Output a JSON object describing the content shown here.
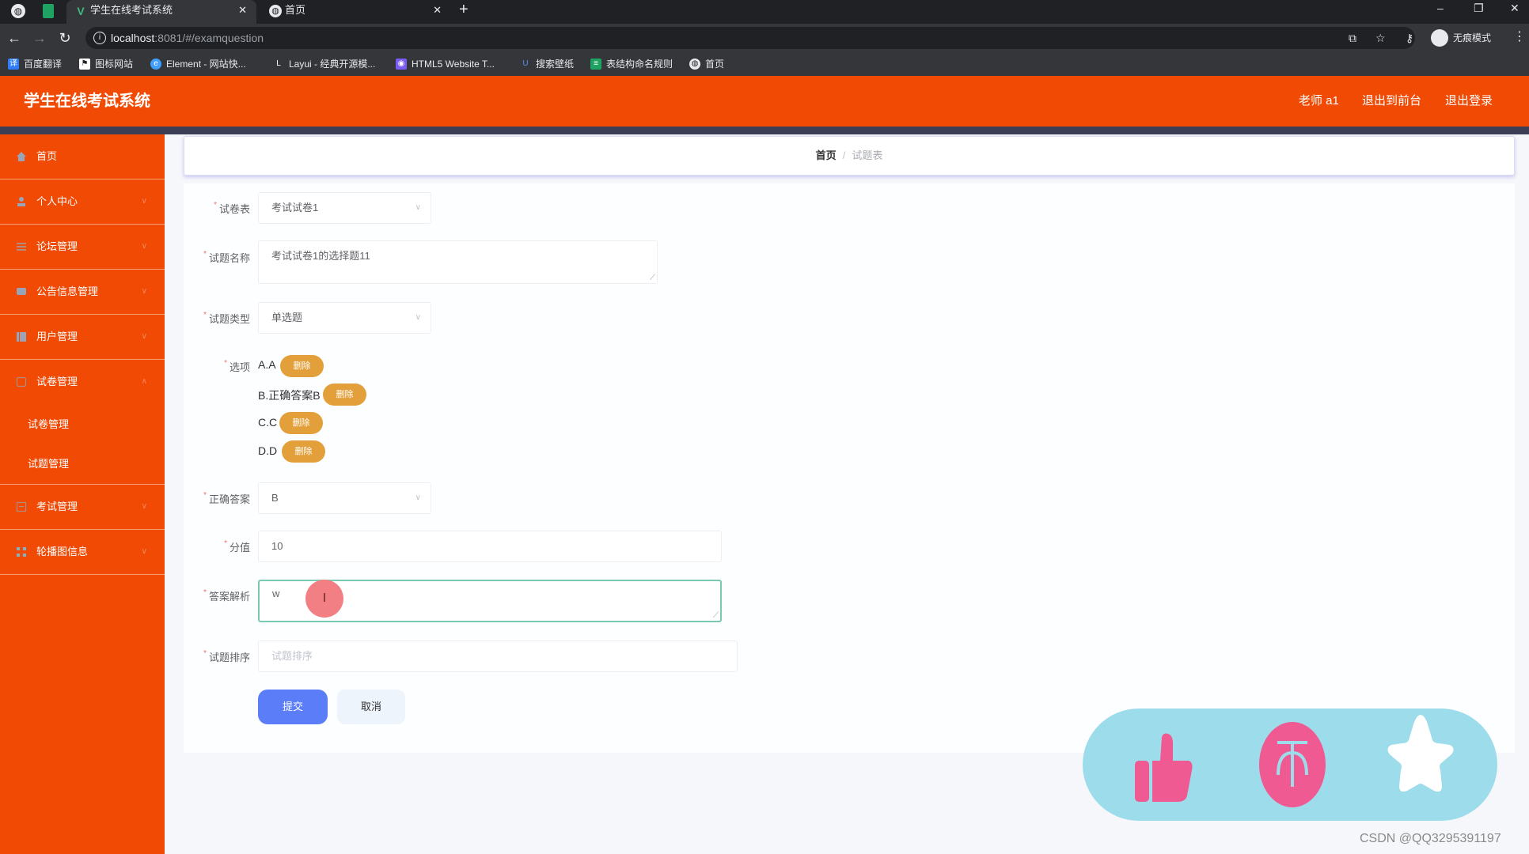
{
  "browser": {
    "tabs": [
      {
        "title": "学生在线考试系统",
        "icon": "vue-logo-icon",
        "active": true
      },
      {
        "title": "首页",
        "icon": "globe-icon",
        "active": false
      }
    ],
    "tab_close_glyph": "✕",
    "new_tab_glyph": "+",
    "url_host": "localhost",
    "url_rest": ":8081/#/examquestion",
    "profile_label": "无痕模式",
    "bookmarks": [
      {
        "label": "百度翻译",
        "icon": "baidu-translate-icon",
        "color": "#2f7cf6"
      },
      {
        "label": "图标网站",
        "icon": "flag-icon",
        "color": "#ffffff"
      },
      {
        "label": "Element - 网站快...",
        "icon": "element-icon",
        "color": "#409eff"
      },
      {
        "label": "Layui - 经典开源模...",
        "icon": "layui-icon",
        "color": "#35363a"
      },
      {
        "label": "HTML5 Website T...",
        "icon": "html5-template-icon",
        "color": "#7b5cf0"
      },
      {
        "label": "搜索壁纸",
        "icon": "wallpaper-icon",
        "color": "#3f6fd8"
      },
      {
        "label": "表结构命名规则",
        "icon": "sheet-icon",
        "color": "#1ea362"
      },
      {
        "label": "首页",
        "icon": "globe-icon",
        "color": "#e8eaed"
      }
    ]
  },
  "app": {
    "title": "学生在线考试系统",
    "user_label": "老师 a1",
    "to_front_label": "退出到前台",
    "logout_label": "退出登录",
    "brand_color": "#f04a04"
  },
  "sidebar": {
    "items": [
      {
        "label": "首页",
        "icon": "home-icon",
        "has_arrow": false
      },
      {
        "label": "个人中心",
        "icon": "user-icon",
        "has_arrow": true
      },
      {
        "label": "论坛管理",
        "icon": "list-icon",
        "has_arrow": true
      },
      {
        "label": "公告信息管理",
        "icon": "notice-icon",
        "has_arrow": true
      },
      {
        "label": "用户管理",
        "icon": "users-icon",
        "has_arrow": true
      },
      {
        "label": "试卷管理",
        "icon": "paper-icon",
        "has_arrow": true,
        "expanded": true,
        "children": [
          {
            "label": "试卷管理"
          },
          {
            "label": "试题管理"
          }
        ]
      },
      {
        "label": "考试管理",
        "icon": "exam-icon",
        "has_arrow": true
      },
      {
        "label": "轮播图信息",
        "icon": "carousel-icon",
        "has_arrow": true
      }
    ]
  },
  "breadcrumb": {
    "home": "首页",
    "separator": "/",
    "current": "试题表"
  },
  "form": {
    "paper": {
      "label": "试卷表",
      "value": "考试试卷1"
    },
    "question_name": {
      "label": "试题名称",
      "value": "考试试卷1的选择题11"
    },
    "question_type": {
      "label": "试题类型",
      "value": "单选题"
    },
    "options": {
      "label": "选项",
      "items": [
        {
          "text": "A.A",
          "delete_label": "删除"
        },
        {
          "text": "B.正确答案B",
          "delete_label": "删除"
        },
        {
          "text": "C.C",
          "delete_label": "删除"
        },
        {
          "text": "D.D",
          "delete_label": "删除"
        }
      ]
    },
    "answer": {
      "label": "正确答案",
      "value": "B"
    },
    "score": {
      "label": "分值",
      "value": "10"
    },
    "analysis": {
      "label": "答案解析",
      "value": "w"
    },
    "order": {
      "label": "试题排序",
      "placeholder": "试题排序",
      "value": ""
    },
    "submit_label": "提交",
    "cancel_label": "取消",
    "required_mark": "*"
  },
  "floating_widget": {
    "actions": [
      {
        "name": "like",
        "icon": "thumbs-up-icon"
      },
      {
        "name": "coin",
        "icon": "coin-icon"
      },
      {
        "name": "favorite",
        "icon": "star-icon"
      }
    ]
  },
  "watermark": "CSDN @QQ3295391197"
}
